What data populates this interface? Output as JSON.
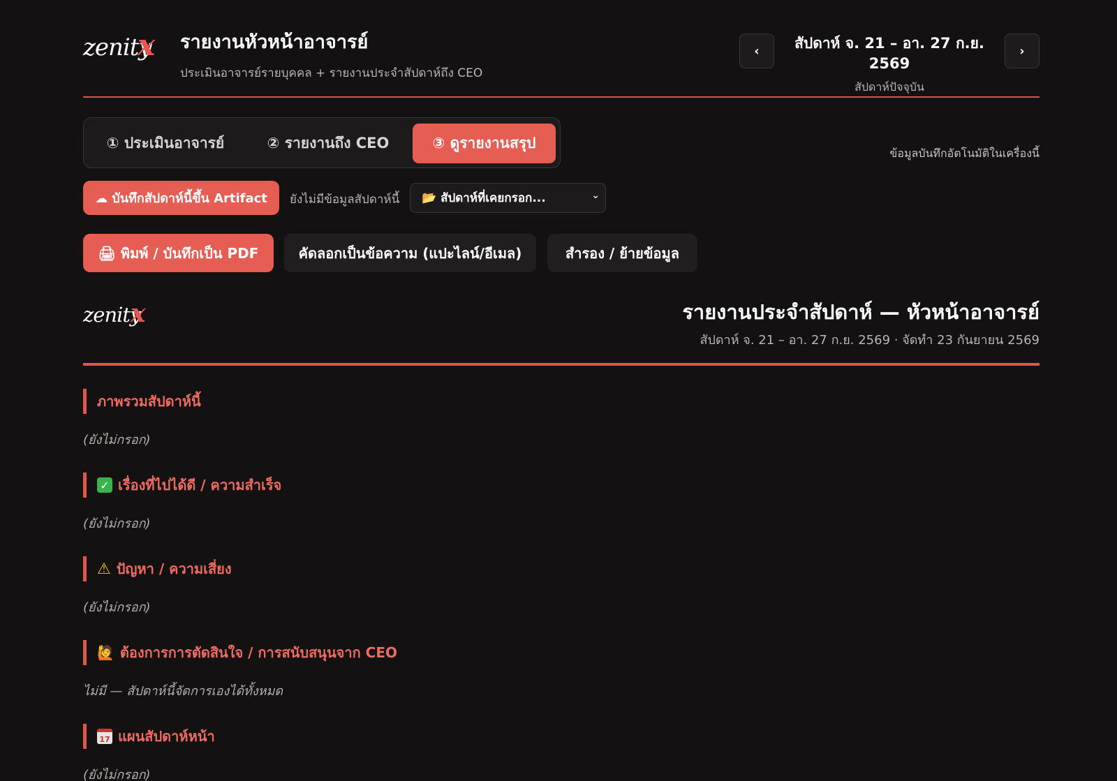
{
  "brand": {
    "logo_word": "zenity",
    "logo_mark": "x",
    "accent": "#e65d54"
  },
  "header": {
    "title": "รายงานหัวหน้าอาจารย์",
    "subtitle": "ประเมินอาจารย์รายบุคคล + รายงานประจำสัปดาห์ถึง CEO"
  },
  "week_nav": {
    "prev_icon": "‹",
    "next_icon": "›",
    "range": "สัปดาห์ จ. 21 – อา. 27 ก.ย. 2569",
    "label": "สัปดาห์ปัจจุบัน"
  },
  "tabs": [
    {
      "label": "① ประเมินอาจารย์",
      "active": false
    },
    {
      "label": "② รายงานถึง CEO",
      "active": false
    },
    {
      "label": "③ ดูรายงานสรุป",
      "active": true
    }
  ],
  "autosave_note": "ข้อมูลบันทึกอัตโนมัติในเครื่องนี้",
  "artifact": {
    "button_label": "☁ บันทึกสัปดาห์นี้ขึ้น Artifact",
    "status_text": "ยังไม่มีข้อมูลสัปดาห์นี้",
    "select_value": "📂 สัปดาห์ที่เคยกรอก...",
    "select_chevron": "⌄"
  },
  "actions": {
    "print_label": "🖨 พิมพ์ / บันทึกเป็น PDF",
    "copy_label": "คัดลอกเป็นข้อความ (แปะไลน์/อีเมล)",
    "backup_label": "สำรอง / ย้ายข้อมูล"
  },
  "report": {
    "title": "รายงานประจำสัปดาห์ — หัวหน้าอาจารย์",
    "meta": "สัปดาห์ จ. 21 – อา. 27 ก.ย. 2569 · จัดทำ 23 กันยายน 2569",
    "sections": [
      {
        "icon": "",
        "heading": "ภาพรวมสัปดาห์นี้",
        "body": "(ยังไม่กรอก)"
      },
      {
        "icon": "check-icon",
        "heading": "เรื่องที่ไปได้ดี / ความสำเร็จ",
        "body": "(ยังไม่กรอก)"
      },
      {
        "icon": "warning-icon",
        "heading": "ปัญหา / ความเสี่ยง",
        "body": "(ยังไม่กรอก)"
      },
      {
        "icon": "person-raising-hand-icon",
        "heading": "ต้องการการตัดสินใจ / การสนับสนุนจาก CEO",
        "body": "ไม่มี — สัปดาห์นี้จัดการเองได้ทั้งหมด"
      },
      {
        "icon": "calendar-icon",
        "heading": "แผนสัปดาห์หน้า",
        "body": "(ยังไม่กรอก)"
      }
    ]
  }
}
